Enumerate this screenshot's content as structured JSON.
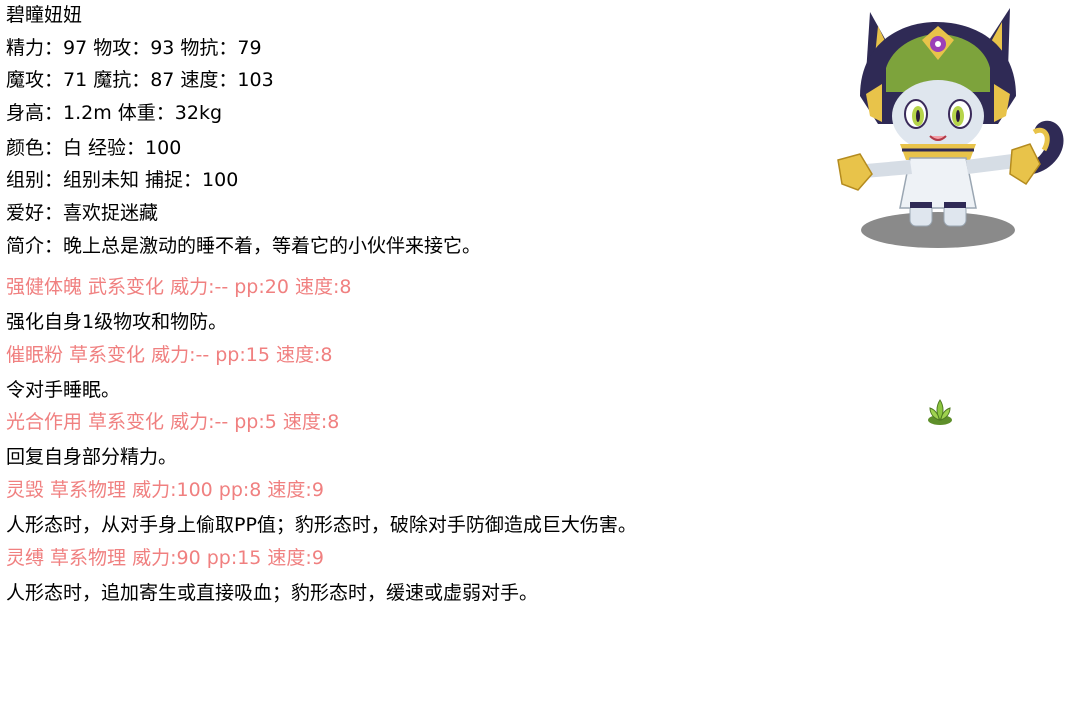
{
  "pet": {
    "name": "碧瞳妞妞",
    "stats_line1": "精力：97 物攻：93 物抗：79",
    "stats_line2": "魔攻：71 魔抗：87 速度：103",
    "size_line": "身高：1.2m 体重：32kg",
    "color_line": "颜色：白 经验：100",
    "group_line": "组别：组别未知 捕捉：100",
    "hobby_line": "爱好：喜欢捉迷藏",
    "intro_line": "简介：晚上总是激动的睡不着，等着它的小伙伴来接它。"
  },
  "skills": [
    {
      "title": "强健体魄 武系变化 威力:-- pp:20 速度:8",
      "desc": "强化自身1级物攻和物防。"
    },
    {
      "title": "催眠粉 草系变化 威力:-- pp:15 速度:8",
      "desc": "令对手睡眠。"
    },
    {
      "title": "光合作用 草系变化 威力:-- pp:5 速度:8",
      "desc": "回复自身部分精力。"
    },
    {
      "title": "灵毁 草系物理 威力:100 pp:8 速度:9",
      "desc": "人形态时，从对手身上偷取PP值；豹形态时，破除对手防御造成巨大伤害。"
    },
    {
      "title": "灵缚 草系物理 威力:90 pp:15 速度:9",
      "desc": "人形态时，追加寄生或直接吸血；豹形态时，缓速或虚弱对手。"
    }
  ],
  "colors": {
    "skill_title": "#f08080",
    "text": "#000000",
    "background": "#ffffff"
  },
  "icons": {
    "portrait": "cat-girl-pet-portrait",
    "element": "grass-element-icon"
  }
}
